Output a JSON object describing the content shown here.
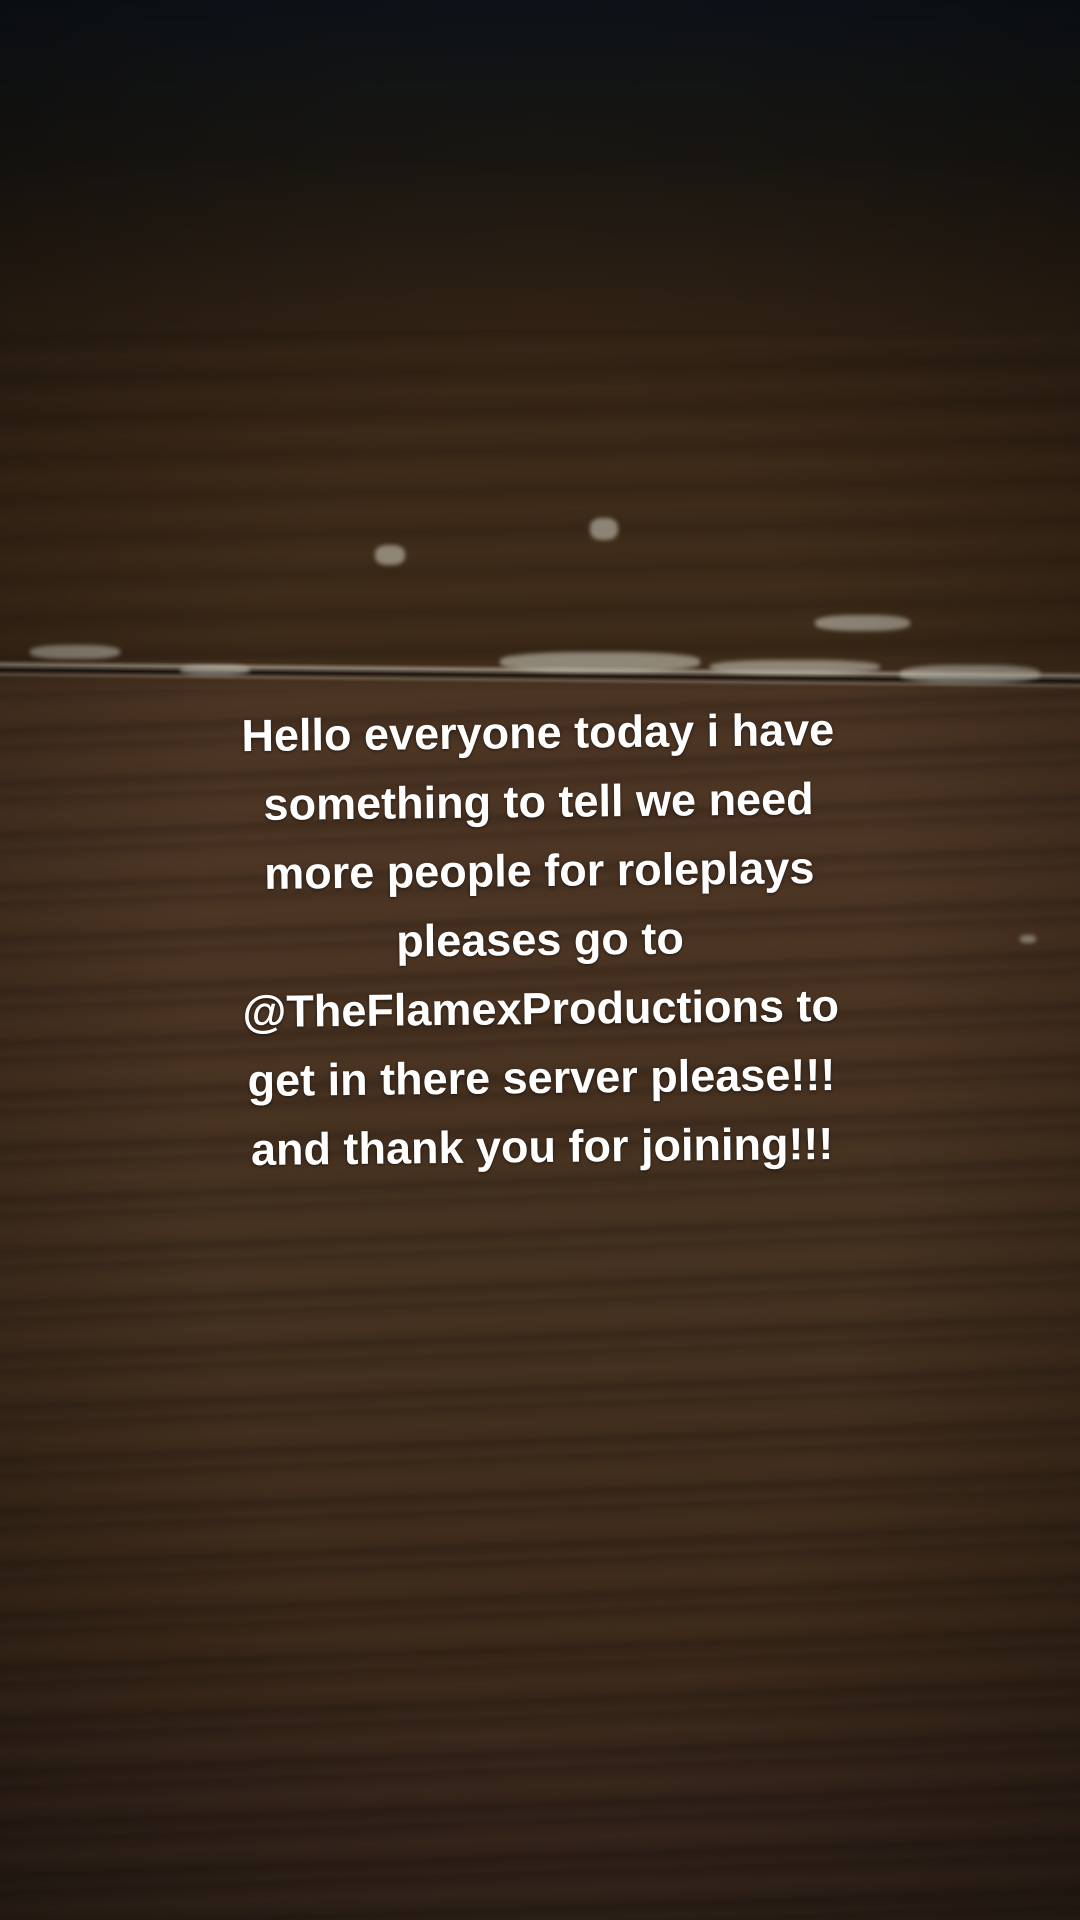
{
  "caption": {
    "lines": [
      "Hello everyone today i have",
      "something to tell we need",
      "more people for roleplays",
      "pleases go to",
      "@TheFlamexProductions to",
      "get in there server please!!!",
      "and thank you for joining!!!"
    ],
    "color": "#ffffff"
  },
  "scene": {
    "background": "dark wooden surface"
  }
}
